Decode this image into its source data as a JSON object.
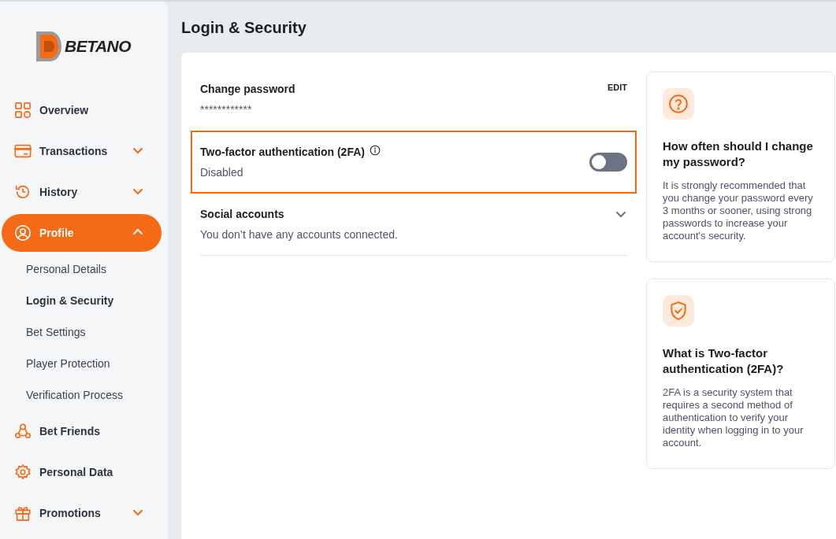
{
  "sidebar": {
    "logo": "BETANO",
    "items": [
      {
        "label": "Overview",
        "selected": false
      },
      {
        "label": "Transactions",
        "selected": false,
        "expanded": false
      },
      {
        "label": "History",
        "selected": false,
        "expanded": false
      },
      {
        "label": "Profile",
        "selected": true,
        "expanded": true,
        "children": [
          {
            "label": "Personal Details",
            "selected": false
          },
          {
            "label": "Login & Security",
            "selected": true
          },
          {
            "label": "Bet Settings",
            "selected": false
          },
          {
            "label": "Player Protection",
            "selected": false
          },
          {
            "label": "Verification Process",
            "selected": false
          }
        ]
      },
      {
        "label": "Bet Friends",
        "selected": false
      },
      {
        "label": "Personal Data",
        "selected": false
      },
      {
        "label": "Promotions",
        "selected": false,
        "expanded": false
      }
    ]
  },
  "page_title": "Login & Security",
  "settings": [
    {
      "kind": "edit",
      "title": "Change password",
      "value": "************",
      "action": "EDIT",
      "highlighted": false
    },
    {
      "kind": "toggle",
      "title": "Two-factor authentication (2FA)",
      "value": "Disabled",
      "on": false,
      "highlighted": true
    },
    {
      "kind": "expand",
      "title": "Social accounts",
      "value": "You don’t have any accounts connected.",
      "expanded": false,
      "highlighted": false
    }
  ],
  "info_cards": [
    {
      "title": "How often should I change my password?",
      "text": "It is strongly recommended that you change your password every 3 months or sooner, using strong passwords to increase your account's security."
    },
    {
      "title": "What is Two-factor authentication (2FA)?",
      "text": "2FA is a security system that requires a second method of authentication to verify your identity when logging in to your account."
    }
  ]
}
